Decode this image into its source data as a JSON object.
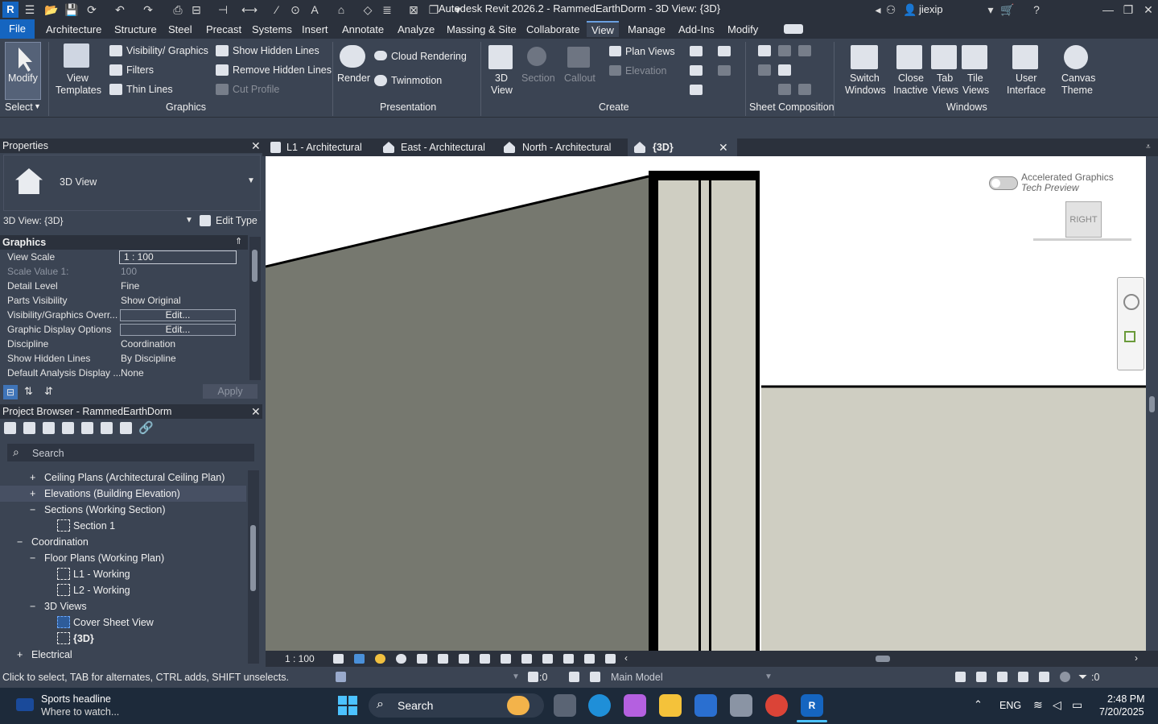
{
  "app": {
    "title": "Autodesk Revit 2026.2 - RammedEarthDorm - 3D View: {3D}",
    "user": "jiexip"
  },
  "tabs": [
    "File",
    "Architecture",
    "Structure",
    "Steel",
    "Precast",
    "Systems",
    "Insert",
    "Annotate",
    "Analyze",
    "Massing & Site",
    "Collaborate",
    "View",
    "Manage",
    "Add-Ins",
    "Modify"
  ],
  "ribbon": {
    "select": {
      "modify": "Modify",
      "select": "Select"
    },
    "graphics": {
      "view_templates_1": "View",
      "view_templates_2": "Templates",
      "visibility": "Visibility/ Graphics",
      "filters": "Filters",
      "thin_lines": "Thin  Lines",
      "show_hidden": "Show  Hidden Lines",
      "remove_hidden": "Remove  Hidden Lines",
      "cut_profile": "Cut  Profile",
      "group": "Graphics"
    },
    "presentation": {
      "render": "Render",
      "cloud_rendering": "Cloud  Rendering",
      "twinmotion": "Twinmotion",
      "group": "Presentation"
    },
    "create": {
      "view3d_1": "3D",
      "view3d_2": "View",
      "section": "Section",
      "callout": "Callout",
      "plan_views": "Plan  Views",
      "elevation": "Elevation",
      "group": "Create"
    },
    "sheet": {
      "group": "Sheet Composition"
    },
    "windows": {
      "switch_1": "Switch",
      "switch_2": "Windows",
      "close_1": "Close",
      "close_2": "Inactive",
      "tab_1": "Tab",
      "tab_2": "Views",
      "tile_1": "Tile",
      "tile_2": "Views",
      "ui_1": "User",
      "ui_2": "Interface",
      "canvas_1": "Canvas",
      "canvas_2": "Theme",
      "group": "Windows"
    }
  },
  "properties": {
    "title": "Properties",
    "type_name": "3D View",
    "selector": "3D View: {3D}",
    "edit_type": "Edit Type",
    "section": "Graphics",
    "rows": [
      {
        "k": "View Scale",
        "v": "1 : 100"
      },
      {
        "k": "Scale Value    1:",
        "v": "100"
      },
      {
        "k": "Detail Level",
        "v": "Fine"
      },
      {
        "k": "Parts Visibility",
        "v": "Show Original"
      },
      {
        "k": "Visibility/Graphics Overr...",
        "v": "Edit..."
      },
      {
        "k": "Graphic Display Options",
        "v": "Edit..."
      },
      {
        "k": "Discipline",
        "v": "Coordination"
      },
      {
        "k": "Show Hidden Lines",
        "v": "By Discipline"
      },
      {
        "k": "Default Analysis Display ...",
        "v": "None"
      }
    ],
    "apply": "Apply"
  },
  "project_browser": {
    "title": "Project Browser - RammedEarthDorm",
    "search_placeholder": "Search",
    "items": [
      {
        "label": "Ceiling Plans (Architectural Ceiling Plan)",
        "sign": "+"
      },
      {
        "label": "Elevations (Building Elevation)",
        "sign": "+"
      },
      {
        "label": "Sections (Working Section)",
        "sign": "−"
      },
      {
        "label": "Section 1",
        "sign": ""
      },
      {
        "label": "Coordination",
        "sign": "−"
      },
      {
        "label": "Floor Plans (Working Plan)",
        "sign": "−"
      },
      {
        "label": "L1 - Working",
        "sign": ""
      },
      {
        "label": "L2 - Working",
        "sign": ""
      },
      {
        "label": "3D Views",
        "sign": "−"
      },
      {
        "label": "Cover Sheet View",
        "sign": ""
      },
      {
        "label": "{3D}",
        "sign": ""
      },
      {
        "label": "Electrical",
        "sign": "+"
      }
    ]
  },
  "view_tabs": [
    "L1 - Architectural",
    "East - Architectural",
    "North - Architectural",
    "{3D}"
  ],
  "canvas": {
    "accel_1": "Accelerated Graphics",
    "accel_2": "Tech Preview",
    "viewcube": "RIGHT"
  },
  "view_bar": {
    "scale": "1 : 100"
  },
  "status": {
    "hint": "Click to select, TAB for alternates, CTRL adds, SHIFT unselects.",
    "zero1": ":0",
    "model": "Main Model",
    "zero2": ":0"
  },
  "taskbar": {
    "news_1": "Sports headline",
    "news_2": "Where to watch...",
    "search": "Search",
    "lang": "ENG",
    "time": "2:48 PM",
    "date": "7/20/2025"
  },
  "colors": {
    "ribbon": "#3b4453",
    "dark": "#2b313c",
    "accent": "#1565c0",
    "wall": "#76786f",
    "wall_light": "#cfcec2"
  }
}
